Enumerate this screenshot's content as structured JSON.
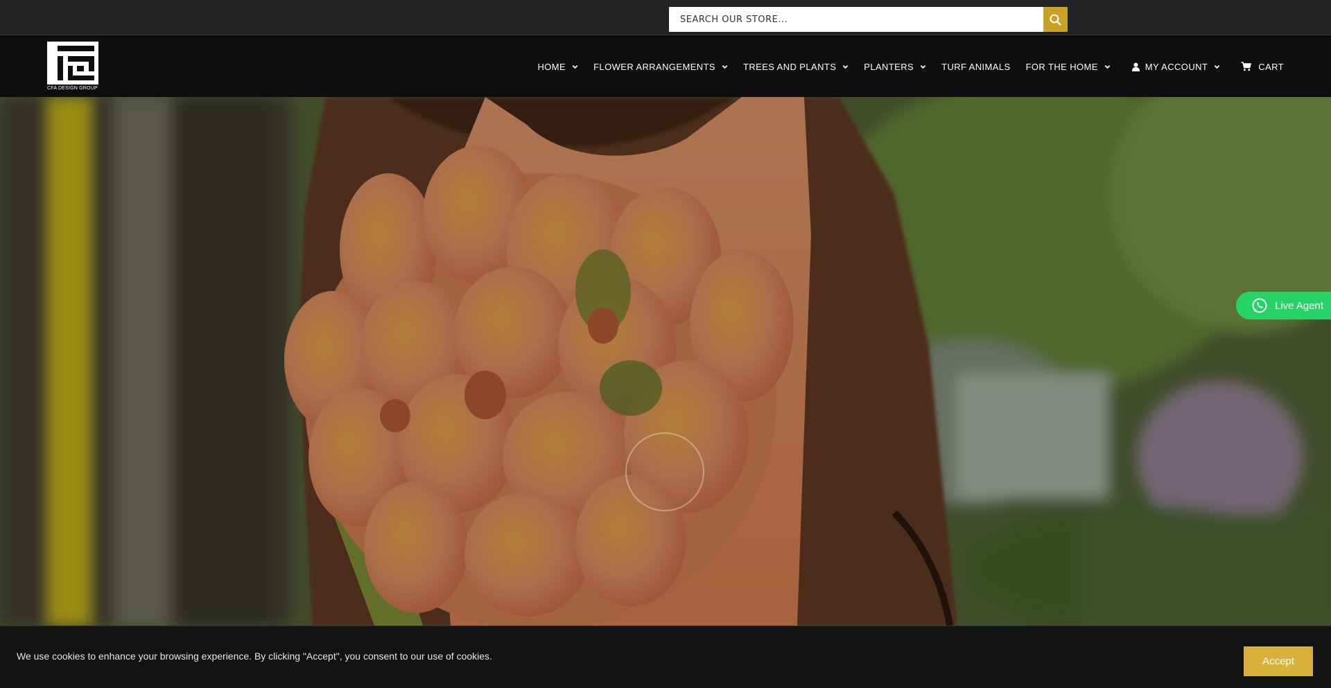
{
  "search": {
    "placeholder": "SEARCH OUR STORE..."
  },
  "brand": {
    "tagline": "CFA DESIGN GROUP"
  },
  "nav": {
    "items": [
      {
        "label": "HOME",
        "dropdown": true
      },
      {
        "label": "FLOWER ARRANGEMENTS",
        "dropdown": true
      },
      {
        "label": "TREES AND PLANTS",
        "dropdown": true
      },
      {
        "label": "PLANTERS",
        "dropdown": true
      },
      {
        "label": "TURF ANIMALS",
        "dropdown": false
      },
      {
        "label": "FOR THE HOME",
        "dropdown": true
      }
    ],
    "account_label": "MY ACCOUNT",
    "cart_label": "CART"
  },
  "live_agent": {
    "label": "Live Agent"
  },
  "cookie": {
    "message": "We use cookies to enhance your browsing experience. By clicking \"Accept\", you consent to our use of cookies.",
    "accept_label": "Accept"
  },
  "colors": {
    "accent": "#c9a227",
    "accept_button": "#d8b03a",
    "whatsapp": "#25d366",
    "header_bg": "#0e0e0e",
    "topbar_bg": "#232323"
  },
  "icons": {
    "search": "search-icon",
    "chevron": "chevron-down-icon",
    "account": "user-icon",
    "cart": "cart-icon",
    "live_agent": "whatsapp-icon"
  }
}
